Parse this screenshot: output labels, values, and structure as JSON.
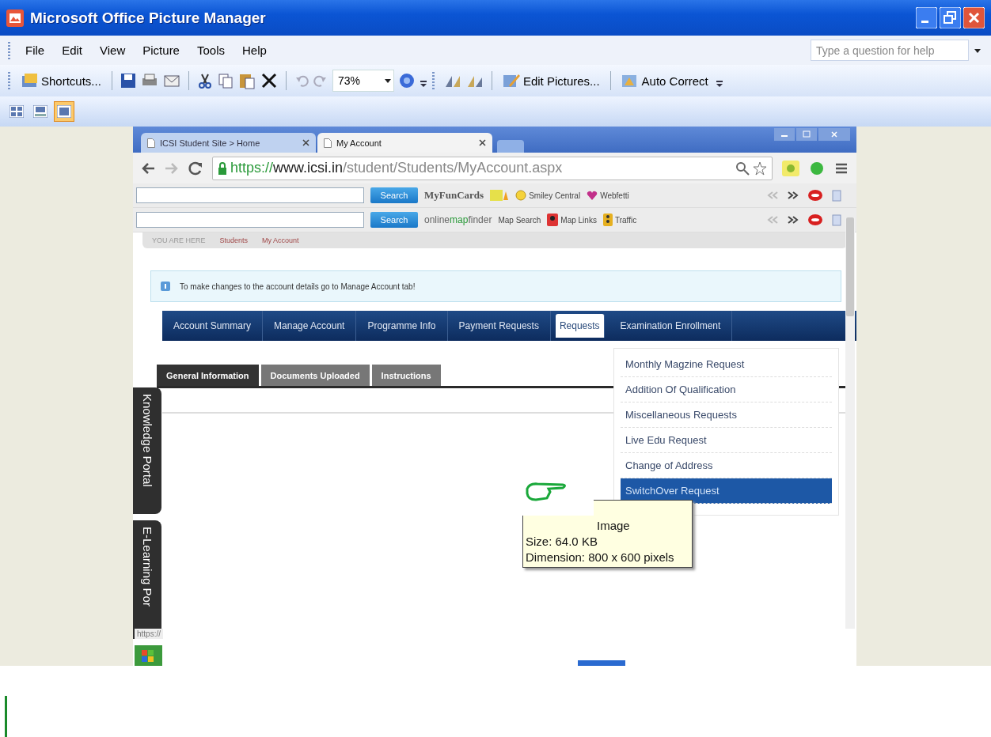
{
  "window": {
    "title": "Microsoft Office Picture Manager"
  },
  "menu": [
    "File",
    "Edit",
    "View",
    "Picture",
    "Tools",
    "Help"
  ],
  "help_field": {
    "placeholder": "Type a question for help"
  },
  "toolbar": {
    "shortcuts": "Shortcuts...",
    "zoom": "73%",
    "edit_pictures": "Edit Pictures...",
    "auto_correct": "Auto Correct"
  },
  "view_buttons": [
    {
      "selected": false
    },
    {
      "selected": false
    },
    {
      "selected": true
    }
  ],
  "browser_tabs": [
    {
      "label": "ICSI Student Site > Home",
      "selected": false
    },
    {
      "label": "My Account",
      "selected": true
    }
  ],
  "address": {
    "scheme": "https://",
    "host": "www.icsi.in",
    "path": "/student/Students/MyAccount.aspx"
  },
  "toolbars": [
    {
      "button": "Search",
      "logo": [
        "MyFunCards"
      ],
      "links": [
        {
          "label": "Smiley Central",
          "kind": "smiley"
        },
        {
          "label": "Webfetti",
          "kind": "heart"
        }
      ]
    },
    {
      "button": "Search",
      "logo": [
        "online",
        "map",
        "finder"
      ],
      "links": [
        {
          "label": "Map Search",
          "kind": "plain"
        },
        {
          "label": "Map Links",
          "kind": "pin"
        },
        {
          "label": "Traffic",
          "kind": "traffic"
        }
      ]
    }
  ],
  "breadcrumb": [
    "YOU ARE HERE",
    "Students",
    "My Account"
  ],
  "notice": "To make changes to the account details go to Manage Account tab!",
  "nav_tabs": [
    {
      "label": "Account Summary",
      "selected": false
    },
    {
      "label": "Manage Account",
      "selected": false
    },
    {
      "label": "Programme Info",
      "selected": false
    },
    {
      "label": "Payment Requests",
      "selected": false
    },
    {
      "label": "Requests",
      "selected": true
    },
    {
      "label": "Examination Enrollment",
      "selected": false
    }
  ],
  "sub_tabs": [
    {
      "label": "General Information",
      "selected": true
    },
    {
      "label": "Documents Uploaded",
      "selected": false
    },
    {
      "label": "Instructions",
      "selected": false
    }
  ],
  "requests_menu": [
    {
      "label": "Monthly Magzine Request",
      "selected": false
    },
    {
      "label": "Addition Of Qualification",
      "selected": false
    },
    {
      "label": "Miscellaneous Requests",
      "selected": false
    },
    {
      "label": "Live Edu Request",
      "selected": false
    },
    {
      "label": "Change of Address",
      "selected": false
    },
    {
      "label": "SwitchOver Request",
      "selected": true
    }
  ],
  "side_tabs": [
    "Knowledge Portal",
    "E-Learning Por"
  ],
  "status_url": "https://",
  "tooltip": {
    "lines": [
      "Image",
      "Size: 64.0 KB",
      "Dimension: 800 x 600 pixels"
    ]
  }
}
